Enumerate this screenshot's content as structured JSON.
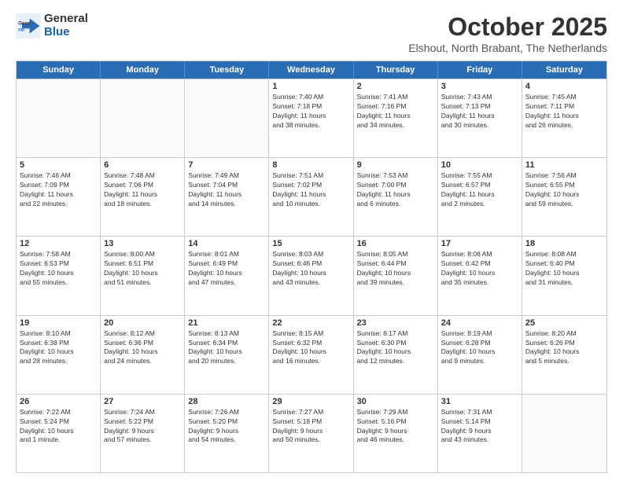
{
  "logo": {
    "general": "General",
    "blue": "Blue"
  },
  "title": "October 2025",
  "location": "Elshout, North Brabant, The Netherlands",
  "headers": [
    "Sunday",
    "Monday",
    "Tuesday",
    "Wednesday",
    "Thursday",
    "Friday",
    "Saturday"
  ],
  "weeks": [
    [
      {
        "day": "",
        "info": ""
      },
      {
        "day": "",
        "info": ""
      },
      {
        "day": "",
        "info": ""
      },
      {
        "day": "1",
        "info": "Sunrise: 7:40 AM\nSunset: 7:18 PM\nDaylight: 11 hours\nand 38 minutes."
      },
      {
        "day": "2",
        "info": "Sunrise: 7:41 AM\nSunset: 7:16 PM\nDaylight: 11 hours\nand 34 minutes."
      },
      {
        "day": "3",
        "info": "Sunrise: 7:43 AM\nSunset: 7:13 PM\nDaylight: 11 hours\nand 30 minutes."
      },
      {
        "day": "4",
        "info": "Sunrise: 7:45 AM\nSunset: 7:11 PM\nDaylight: 11 hours\nand 26 minutes."
      }
    ],
    [
      {
        "day": "5",
        "info": "Sunrise: 7:46 AM\nSunset: 7:09 PM\nDaylight: 11 hours\nand 22 minutes."
      },
      {
        "day": "6",
        "info": "Sunrise: 7:48 AM\nSunset: 7:06 PM\nDaylight: 11 hours\nand 18 minutes."
      },
      {
        "day": "7",
        "info": "Sunrise: 7:49 AM\nSunset: 7:04 PM\nDaylight: 11 hours\nand 14 minutes."
      },
      {
        "day": "8",
        "info": "Sunrise: 7:51 AM\nSunset: 7:02 PM\nDaylight: 11 hours\nand 10 minutes."
      },
      {
        "day": "9",
        "info": "Sunrise: 7:53 AM\nSunset: 7:00 PM\nDaylight: 11 hours\nand 6 minutes."
      },
      {
        "day": "10",
        "info": "Sunrise: 7:55 AM\nSunset: 6:57 PM\nDaylight: 11 hours\nand 2 minutes."
      },
      {
        "day": "11",
        "info": "Sunrise: 7:56 AM\nSunset: 6:55 PM\nDaylight: 10 hours\nand 59 minutes."
      }
    ],
    [
      {
        "day": "12",
        "info": "Sunrise: 7:58 AM\nSunset: 6:53 PM\nDaylight: 10 hours\nand 55 minutes."
      },
      {
        "day": "13",
        "info": "Sunrise: 8:00 AM\nSunset: 6:51 PM\nDaylight: 10 hours\nand 51 minutes."
      },
      {
        "day": "14",
        "info": "Sunrise: 8:01 AM\nSunset: 6:49 PM\nDaylight: 10 hours\nand 47 minutes."
      },
      {
        "day": "15",
        "info": "Sunrise: 8:03 AM\nSunset: 6:46 PM\nDaylight: 10 hours\nand 43 minutes."
      },
      {
        "day": "16",
        "info": "Sunrise: 8:05 AM\nSunset: 6:44 PM\nDaylight: 10 hours\nand 39 minutes."
      },
      {
        "day": "17",
        "info": "Sunrise: 8:06 AM\nSunset: 6:42 PM\nDaylight: 10 hours\nand 35 minutes."
      },
      {
        "day": "18",
        "info": "Sunrise: 8:08 AM\nSunset: 6:40 PM\nDaylight: 10 hours\nand 31 minutes."
      }
    ],
    [
      {
        "day": "19",
        "info": "Sunrise: 8:10 AM\nSunset: 6:38 PM\nDaylight: 10 hours\nand 28 minutes."
      },
      {
        "day": "20",
        "info": "Sunrise: 8:12 AM\nSunset: 6:36 PM\nDaylight: 10 hours\nand 24 minutes."
      },
      {
        "day": "21",
        "info": "Sunrise: 8:13 AM\nSunset: 6:34 PM\nDaylight: 10 hours\nand 20 minutes."
      },
      {
        "day": "22",
        "info": "Sunrise: 8:15 AM\nSunset: 6:32 PM\nDaylight: 10 hours\nand 16 minutes."
      },
      {
        "day": "23",
        "info": "Sunrise: 8:17 AM\nSunset: 6:30 PM\nDaylight: 10 hours\nand 12 minutes."
      },
      {
        "day": "24",
        "info": "Sunrise: 8:19 AM\nSunset: 6:28 PM\nDaylight: 10 hours\nand 9 minutes."
      },
      {
        "day": "25",
        "info": "Sunrise: 8:20 AM\nSunset: 6:26 PM\nDaylight: 10 hours\nand 5 minutes."
      }
    ],
    [
      {
        "day": "26",
        "info": "Sunrise: 7:22 AM\nSunset: 5:24 PM\nDaylight: 10 hours\nand 1 minute."
      },
      {
        "day": "27",
        "info": "Sunrise: 7:24 AM\nSunset: 5:22 PM\nDaylight: 9 hours\nand 57 minutes."
      },
      {
        "day": "28",
        "info": "Sunrise: 7:26 AM\nSunset: 5:20 PM\nDaylight: 9 hours\nand 54 minutes."
      },
      {
        "day": "29",
        "info": "Sunrise: 7:27 AM\nSunset: 5:18 PM\nDaylight: 9 hours\nand 50 minutes."
      },
      {
        "day": "30",
        "info": "Sunrise: 7:29 AM\nSunset: 5:16 PM\nDaylight: 9 hours\nand 46 minutes."
      },
      {
        "day": "31",
        "info": "Sunrise: 7:31 AM\nSunset: 5:14 PM\nDaylight: 9 hours\nand 43 minutes."
      },
      {
        "day": "",
        "info": ""
      }
    ]
  ]
}
